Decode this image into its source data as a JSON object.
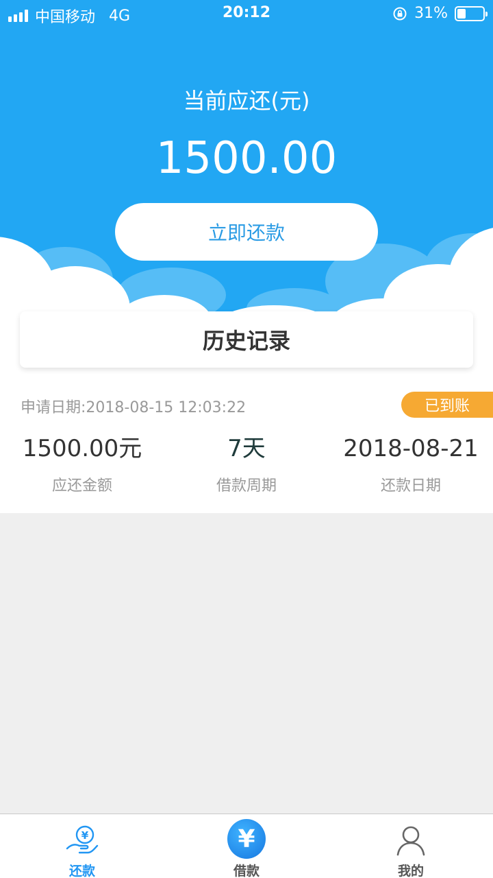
{
  "status_bar": {
    "carrier": "中国移动",
    "network": "4G",
    "time": "20:12",
    "battery": "31%"
  },
  "hero": {
    "due_label": "当前应还(元)",
    "due_amount": "1500.00",
    "repay_button": "立即还款"
  },
  "history": {
    "title": "历史记录",
    "record": {
      "apply_date": "申请日期:2018-08-15 12:03:22",
      "status": "已到账",
      "amount": "1500.00元",
      "amount_label": "应还金额",
      "period": "7天",
      "period_label": "借款周期",
      "repay_date": "2018-08-21",
      "repay_date_label": "还款日期"
    }
  },
  "tabbar": {
    "tabs": [
      {
        "label": "还款",
        "icon": "hand-yuan-icon",
        "active": true
      },
      {
        "label": "借款",
        "icon": "yuan-circle-icon",
        "active": false
      },
      {
        "label": "我的",
        "icon": "user-icon",
        "active": false
      }
    ]
  },
  "colors": {
    "primary": "#22a7f3",
    "badge": "#f6a933",
    "tab_active": "#2196f3"
  }
}
